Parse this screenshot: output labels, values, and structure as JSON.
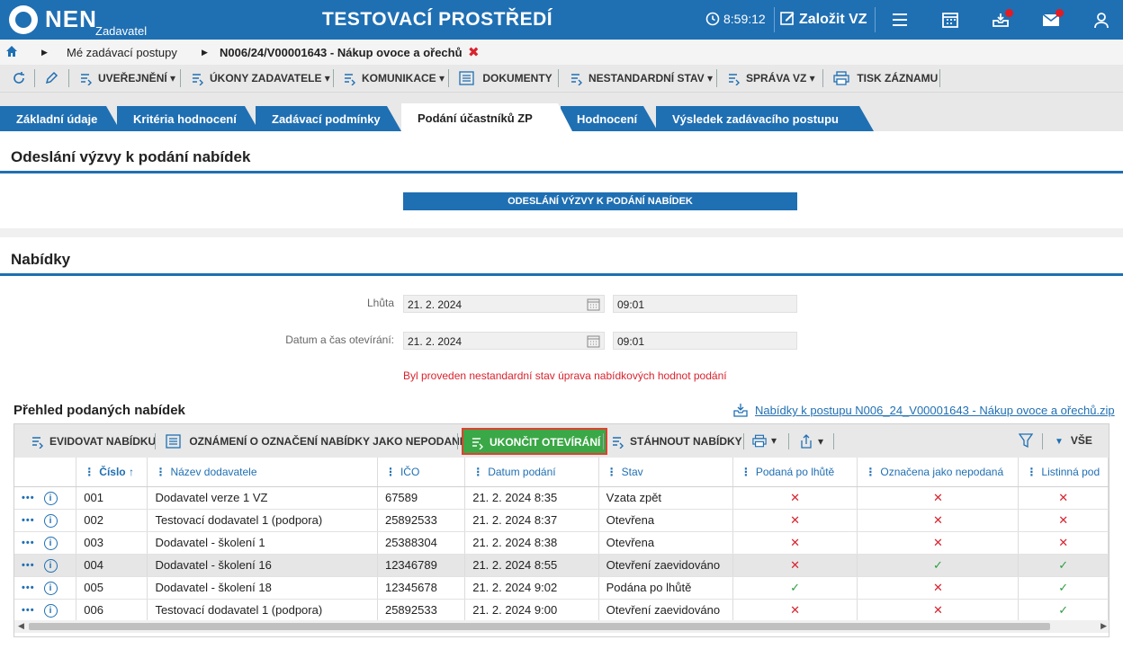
{
  "app": {
    "logo_text": "NEN",
    "logo_sub": "Zadavatel",
    "env_title": "TESTOVACÍ PROSTŘEDÍ",
    "time": "8:59:12",
    "new_vz_label": "Založit VZ"
  },
  "breadcrumb": {
    "item1": "Mé zadávací postupy",
    "item2": "N006/24/V00001643 - Nákup ovoce a ořechů",
    "close": "✖"
  },
  "toolbar": {
    "uverejneni": "UVEŘEJNĚNÍ",
    "ukony": "ÚKONY ZADAVATELE",
    "komunikace": "KOMUNIKACE",
    "dokumenty": "DOKUMENTY",
    "nestandardni": "NESTANDARDNÍ STAV",
    "sprava": "SPRÁVA VZ",
    "tisk": "TISK ZÁZNAMU"
  },
  "tabs": [
    {
      "label": "Základní údaje"
    },
    {
      "label": "Kritéria hodnocení"
    },
    {
      "label": "Zadávací podmínky"
    },
    {
      "label": "Podání účastníků ZP"
    },
    {
      "label": "Hodnocení"
    },
    {
      "label": "Výsledek zadávacího postupu"
    }
  ],
  "section1": {
    "title": "Odeslání výzvy k podání nabídek",
    "button": "ODESLÁNÍ VÝZVY K PODÁNÍ NABÍDEK"
  },
  "section2": {
    "title": "Nabídky",
    "lhuta_label": "Lhůta",
    "lhuta_date": "21. 2. 2024",
    "lhuta_time": "09:01",
    "otevirani_label": "Datum a čas otevírání:",
    "otevirani_date": "21. 2. 2024",
    "otevirani_time": "09:01",
    "warning": "Byl proveden nestandardní stav úprava nabídkových hodnot podání"
  },
  "overview": {
    "title": "Přehled podaných nabídek",
    "download_link": "Nabídky k postupu N006_24_V00001643 - Nákup ovoce a ořechů.zip"
  },
  "grid_toolbar": {
    "evidovat": "EVIDOVAT NABÍDKU",
    "oznameni": "OZNÁMENÍ O OZNAČENÍ NABÍDKY JAKO NEPODANÉ",
    "ukoncit": "UKONČIT OTEVÍRÁNÍ",
    "stahnout": "STÁHNOUT NABÍDKY",
    "vse": "VŠE"
  },
  "columns": [
    "Číslo",
    "Název dodavatele",
    "IČO",
    "Datum podání",
    "Stav",
    "Podaná po lhůtě",
    "Označena jako nepodaná",
    "Listinná pod"
  ],
  "sort_arrow": "↑",
  "rows": [
    {
      "cislo": "001",
      "nazev": "Dodavatel verze 1 VZ",
      "ico": "67589",
      "datum": "21. 2. 2024 8:35",
      "stav": "Vzata zpět",
      "po_lhute": "no",
      "nepodana": "no",
      "listinna": "no"
    },
    {
      "cislo": "002",
      "nazev": "Testovací dodavatel 1 (podpora)",
      "ico": "25892533",
      "datum": "21. 2. 2024 8:37",
      "stav": "Otevřena",
      "po_lhute": "no",
      "nepodana": "no",
      "listinna": "no"
    },
    {
      "cislo": "003",
      "nazev": "Dodavatel - školení 1",
      "ico": "25388304",
      "datum": "21. 2. 2024 8:38",
      "stav": "Otevřena",
      "po_lhute": "no",
      "nepodana": "no",
      "listinna": "no"
    },
    {
      "cislo": "004",
      "nazev": "Dodavatel - školení 16",
      "ico": "12346789",
      "datum": "21. 2. 2024 8:55",
      "stav": "Otevření zaevidováno",
      "po_lhute": "no",
      "nepodana": "yes",
      "listinna": "yes"
    },
    {
      "cislo": "005",
      "nazev": "Dodavatel - školení 18",
      "ico": "12345678",
      "datum": "21. 2. 2024 9:02",
      "stav": "Podána po lhůtě",
      "po_lhute": "yes",
      "nepodana": "no",
      "listinna": "yes"
    },
    {
      "cislo": "006",
      "nazev": "Testovací dodavatel 1 (podpora)",
      "ico": "25892533",
      "datum": "21. 2. 2024 9:00",
      "stav": "Otevření zaevidováno",
      "po_lhute": "no",
      "nepodana": "no",
      "listinna": "yes"
    }
  ],
  "icons": {
    "yes": "✓",
    "no": "✕",
    "more": "•••",
    "info": "i"
  },
  "colors": {
    "brand": "#1f6fb3",
    "danger": "#d9232e",
    "success": "#3aa846"
  }
}
